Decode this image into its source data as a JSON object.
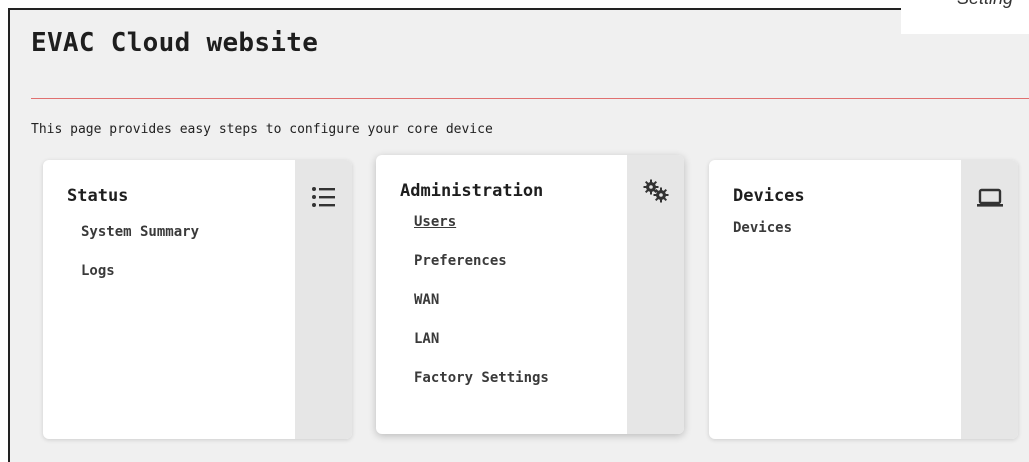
{
  "corner_label": "Setting",
  "page": {
    "title": "EVAC Cloud website",
    "intro": "This page provides easy steps to configure your core device",
    "accent_rule_color": "#e07070"
  },
  "cards": {
    "status": {
      "title": "Status",
      "icon": "list-icon",
      "links": [
        "System Summary",
        "Logs"
      ]
    },
    "administration": {
      "title": "Administration",
      "icon": "gears-icon",
      "links": [
        "Users",
        "Preferences",
        "WAN",
        "LAN",
        "Factory Settings"
      ]
    },
    "devices": {
      "title": "Devices",
      "icon": "laptop-icon",
      "links": [
        "Devices"
      ]
    }
  }
}
